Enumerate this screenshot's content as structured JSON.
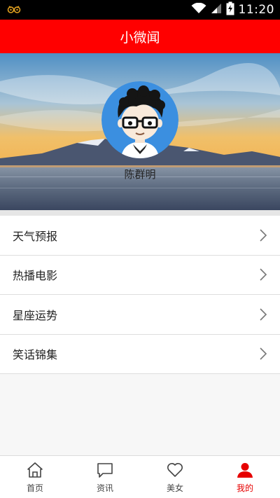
{
  "status_bar": {
    "time": "11:20",
    "left_icon": "owl-glasses-icon",
    "icons": [
      "wifi-icon",
      "signal-icon",
      "battery-icon"
    ]
  },
  "app": {
    "title": "小微闻",
    "accent_color": "#ff0000"
  },
  "profile": {
    "name": "陈群明",
    "avatar_icon": "cartoon-avatar-icon"
  },
  "menu": {
    "items": [
      {
        "label": "天气预报",
        "icon": "chevron-right-icon"
      },
      {
        "label": "热播电影",
        "icon": "chevron-right-icon"
      },
      {
        "label": "星座运势",
        "icon": "chevron-right-icon"
      },
      {
        "label": "笑话锦集",
        "icon": "chevron-right-icon"
      }
    ]
  },
  "tabs": [
    {
      "label": "首页",
      "icon": "home-icon",
      "active": false
    },
    {
      "label": "资讯",
      "icon": "message-icon",
      "active": false
    },
    {
      "label": "美女",
      "icon": "heart-icon",
      "active": false
    },
    {
      "label": "我的",
      "icon": "user-icon",
      "active": true
    }
  ],
  "active_tab_color": "#e60000"
}
